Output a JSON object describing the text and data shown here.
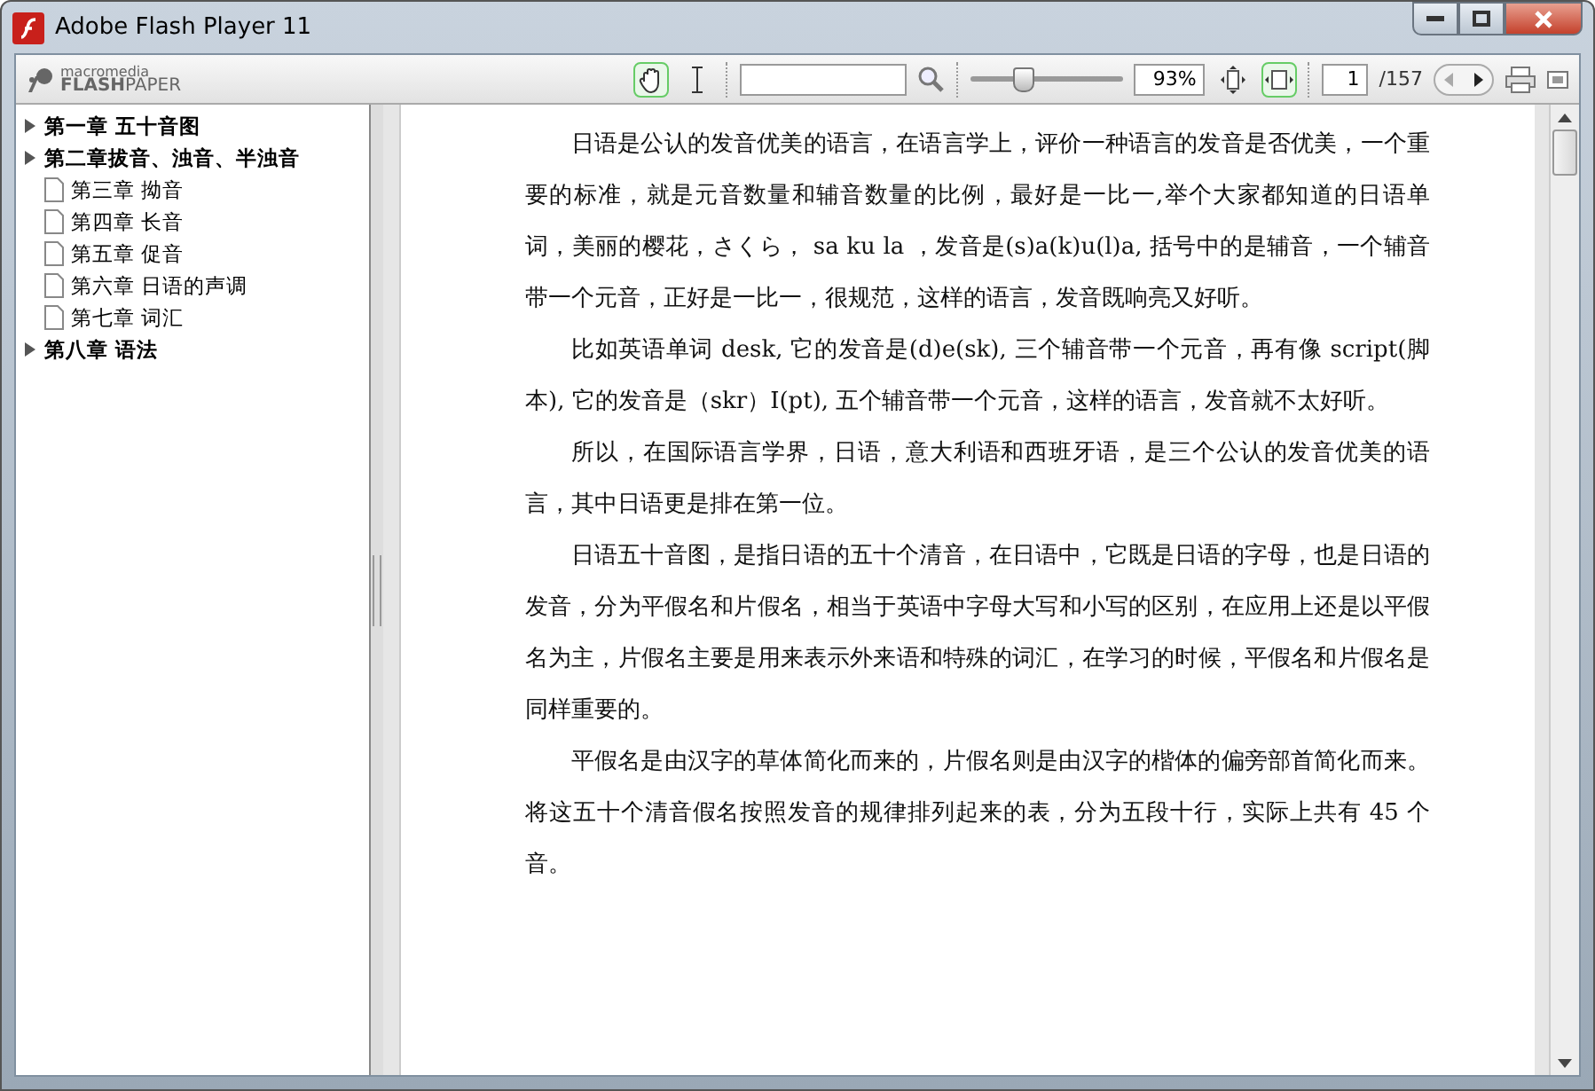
{
  "window": {
    "title": "Adobe Flash Player 11"
  },
  "toolbar": {
    "logo_top": "macromedia",
    "logo_bold": "FLASH",
    "logo_rest": "PAPER",
    "tools": [
      {
        "kind": "hand",
        "selected": true
      },
      {
        "kind": "text",
        "selected": false
      }
    ],
    "zoom": {
      "level": 0.33,
      "value": "93%"
    },
    "fit": [
      {
        "kind": "height",
        "selected": false
      },
      {
        "kind": "width",
        "selected": true
      }
    ],
    "page": {
      "value": "1",
      "total": "/157"
    }
  },
  "outline": [
    {
      "kind": "section",
      "label": "第一章 五十音图",
      "expanded": false
    },
    {
      "kind": "section",
      "label": "第二章拔音、浊音、半浊音",
      "expanded": false
    },
    {
      "kind": "page",
      "label": "第三章 拗音"
    },
    {
      "kind": "page",
      "label": "第四章  长音"
    },
    {
      "kind": "page",
      "label": "第五章  促音"
    },
    {
      "kind": "page",
      "label": "第六章  日语的声调"
    },
    {
      "kind": "page",
      "label": "第七章  词汇"
    },
    {
      "kind": "section",
      "label": "第八章  语法",
      "expanded": false
    }
  ],
  "paragraphs": [
    "日语是公认的发音优美的语言，在语言学上，评价一种语言的发音是否优美，一个重要的标准，就是元音数量和辅音数量的比例，最好是一比一,举个大家都知道的日语单词，美丽的樱花，さくら， sa ku la ，发音是(s)a(k)u(l)a, 括号中的是辅音，一个辅音带一个元音，正好是一比一，很规范，这样的语言，发音既响亮又好听。",
    "比如英语单词 desk, 它的发音是(d)e(sk), 三个辅音带一个元音，再有像 script(脚本), 它的发音是（skr）I(pt), 五个辅音带一个元音，这样的语言，发音就不太好听。",
    "所以，在国际语言学界，日语，意大利语和西班牙语，是三个公认的发音优美的语言，其中日语更是排在第一位。",
    "日语五十音图，是指日语的五十个清音，在日语中，它既是日语的字母，也是日语的发音，分为平假名和片假名，相当于英语中字母大写和小写的区别，在应用上还是以平假名为主，片假名主要是用来表示外来语和特殊的词汇，在学习的时候，平假名和片假名是同样重要的。",
    "平假名是由汉字的草体简化而来的，片假名则是由汉字的楷体的偏旁部首简化而来。将这五十个清音假名按照发音的规律排列起来的表，分为五段十行，实际上共有 45 个音。"
  ]
}
